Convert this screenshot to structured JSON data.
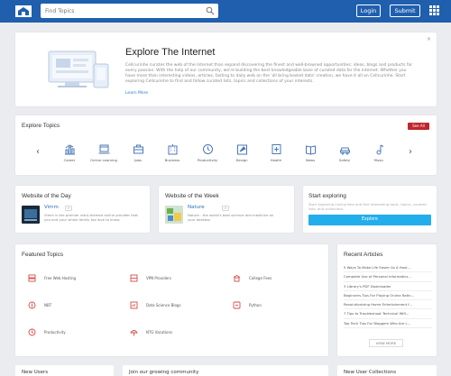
{
  "header": {
    "search_placeholder": "Find Topics",
    "login_label": "Login",
    "submit_label": "Submit"
  },
  "hero": {
    "title": "Explore The Internet",
    "body": "Cellcurinhe curates the web of the Internet than expand discovering the finest and well-browned opportunities: ideas, blogs and products for every passion. With the help of our community, we're building the best knowledgeable base of curated data for the internet. Whether you have more than interesting videos, articles, fasting to daily web on the 'all bring basket data' creation, we have it all on Cellcurinhe. Start exploring Cellcurinhe to find and follow curated lists, topics and collections of your interests.",
    "more_link": "Learn More",
    "close_label": "×"
  },
  "explore_topics": {
    "title": "Explore Topics",
    "see_all": "See All",
    "items": [
      {
        "label": "Career",
        "icon": "chart-icon"
      },
      {
        "label": "Online Learning",
        "icon": "laptop-icon"
      },
      {
        "label": "Jobs",
        "icon": "briefcase-icon"
      },
      {
        "label": "Business",
        "icon": "building-icon"
      },
      {
        "label": "Productivity",
        "icon": "clock-icon"
      },
      {
        "label": "Design",
        "icon": "palette-icon"
      },
      {
        "label": "Health",
        "icon": "heart-icon"
      },
      {
        "label": "News",
        "icon": "newspaper-icon"
      },
      {
        "label": "Safety",
        "icon": "car-icon"
      },
      {
        "label": "Music",
        "icon": "music-icon"
      }
    ]
  },
  "website_of_day": {
    "title": "Website of the Day",
    "site_name": "Vimm",
    "badge": "+",
    "desc": "Vimm is the premier retro-themed online provider that you and your whole family too love to know."
  },
  "website_of_week": {
    "title": "Website of the Week",
    "site_name": "Nature",
    "badge": "+",
    "desc": "Nature - the world's best science and medicine on your desktop"
  },
  "start_exploring": {
    "title": "Start exploring",
    "subtitle": "Start exploring Cellcurinhe and find interesting topic, topics, curated lists, and collections",
    "button": "Explore"
  },
  "featured": {
    "title": "Featured Topics",
    "items": [
      {
        "label": "Free Web Hosting",
        "icon": "hosting-icon"
      },
      {
        "label": "VPN Providers",
        "icon": "vpn-icon"
      },
      {
        "label": "College Fees",
        "icon": "college-icon"
      },
      {
        "label": "NBT",
        "icon": "nbt-icon"
      },
      {
        "label": "Data Science Blogs",
        "icon": "data-icon"
      },
      {
        "label": "Python",
        "icon": "python-icon"
      },
      {
        "label": "Productivity",
        "icon": "clock-icon"
      },
      {
        "label": "NTG Vacations",
        "icon": "beach-icon"
      }
    ]
  },
  "recent_articles": {
    "title": "Recent Articles",
    "items": [
      "5 Ways To Make Life Easier As A Host...",
      "Complete Use of Personal Informatics...",
      "3 Library's PDF Downloader",
      "Beginners Tips For Playing Online Ratin...",
      "Revolutionizing Home Entertainment f...",
      "7 Tips to Troubleshoot Technical Wifi...",
      "Top Tech Tips For Bloggers Who Are L..."
    ],
    "view_more": "VIEW MORE"
  },
  "bottom": {
    "new_users": "New Users",
    "join": "Join our growing community",
    "new_collections": "New User Collections"
  },
  "colors": {
    "header_blue": "#1f5fad",
    "explore_button": "#21aeea",
    "see_all": "#c0272d",
    "featured_icon": "#d64a4a"
  }
}
